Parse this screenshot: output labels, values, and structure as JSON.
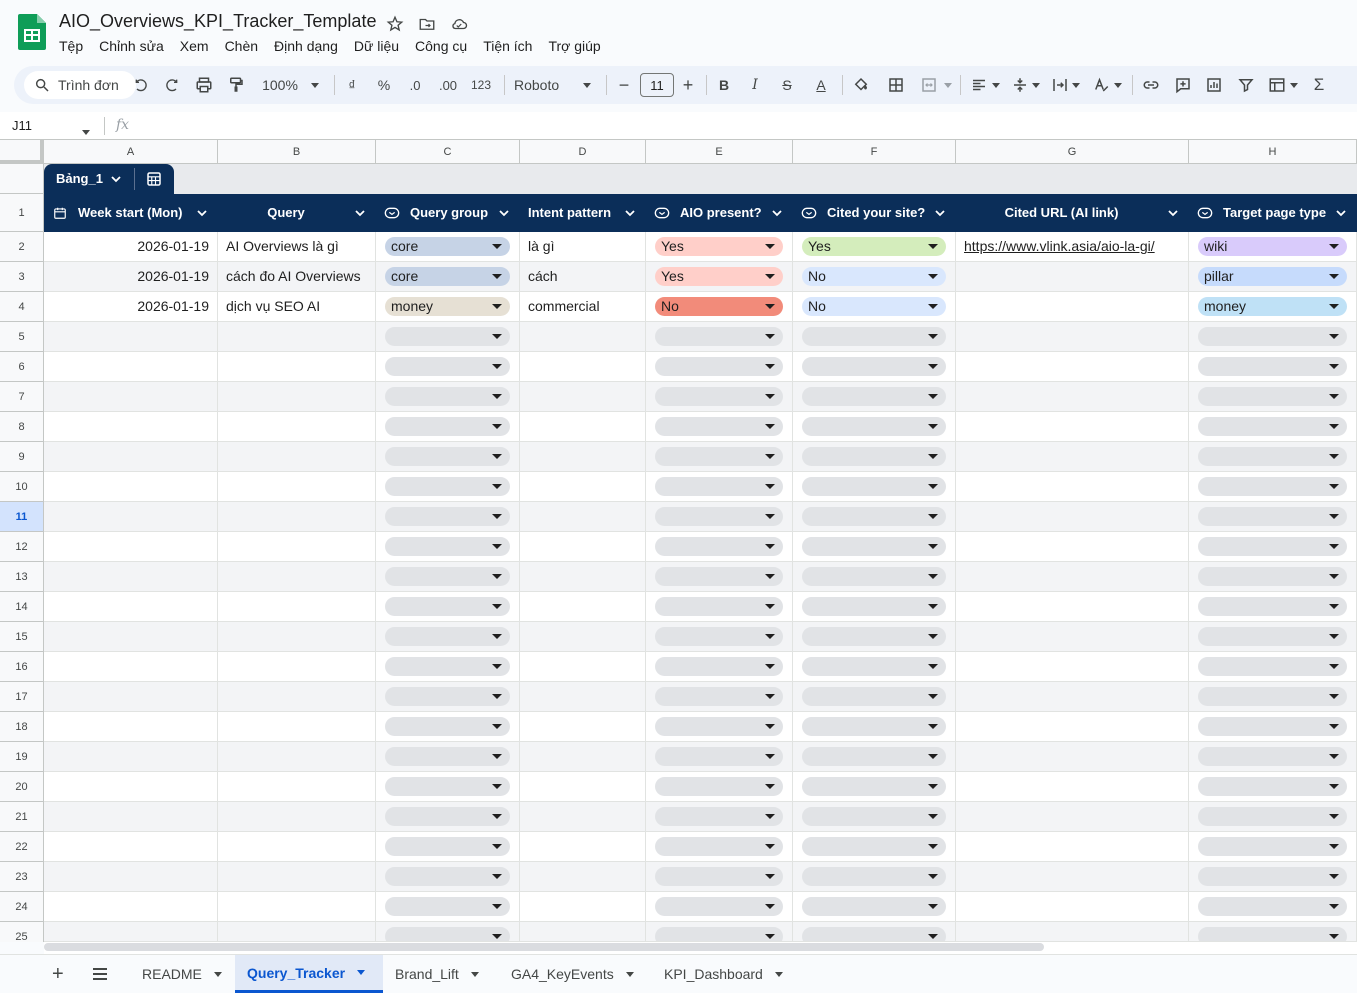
{
  "document": {
    "title": "AIO_Overviews_KPI_Tracker_Template"
  },
  "menu": [
    "Tệp",
    "Chỉnh sửa",
    "Xem",
    "Chèn",
    "Định dạng",
    "Dữ liệu",
    "Công cụ",
    "Tiện ích",
    "Trợ giúp"
  ],
  "toolbar": {
    "search_label": "Trình đơn",
    "zoom": "100%",
    "currency": "₫",
    "percent": "%",
    "decrease_decimal": ".0",
    "increase_decimal": ".00",
    "number_format": "123",
    "font": "Roboto",
    "font_size": "11",
    "minus": "−",
    "plus": "+",
    "bold": "B",
    "italic": "I",
    "strike": "S",
    "text_color": "A",
    "sum": "Σ"
  },
  "formula_bar": {
    "name_box": "J11",
    "fx": "fx"
  },
  "columns": [
    "A",
    "B",
    "C",
    "D",
    "E",
    "F",
    "G",
    "H"
  ],
  "table": {
    "name": "Bảng_1",
    "headers": [
      "Week start (Mon)",
      "Query",
      "Query group",
      "Intent pattern",
      "AIO present?",
      "Cited your site?",
      "Cited URL (AI link)",
      "Target page type"
    ],
    "rows": [
      {
        "week": "2026-01-19",
        "query": "AI Overviews là gì",
        "group": "core",
        "intent": "là gì",
        "aio": "Yes",
        "cited": "Yes",
        "url": "https://www.vlink.asia/aio-la-gi/",
        "target": "wiki"
      },
      {
        "week": "2026-01-19",
        "query": "cách đo AI Overviews",
        "group": "core",
        "intent": "cách",
        "aio": "Yes",
        "cited": "No",
        "url": "",
        "target": "pillar"
      },
      {
        "week": "2026-01-19",
        "query": "dịch vụ SEO AI",
        "group": "money",
        "intent": "commercial",
        "aio": "No",
        "cited": "No",
        "url": "",
        "target": "money"
      }
    ]
  },
  "row_numbers": [
    "1",
    "2",
    "3",
    "4",
    "5",
    "6",
    "7",
    "8",
    "9",
    "10",
    "11",
    "12",
    "13",
    "14",
    "15",
    "16",
    "17",
    "18",
    "19",
    "20",
    "21",
    "22",
    "23",
    "24",
    "25"
  ],
  "selected_row": "11",
  "chip_colors": {
    "core": "#c6d3e6",
    "money_group": "#e6e0d4",
    "aio_yes": "#ffcfc9",
    "aio_no": "#f28b7a",
    "cited_yes": "#d4edbc",
    "cited_no": "#d9e7fd",
    "wiki": "#d9cbfb",
    "pillar": "#c6dbfc",
    "money_target": "#bfe1f6",
    "empty": "#e1e3e6",
    "header": "#0b2e59"
  },
  "sheets": [
    {
      "name": "README",
      "active": false
    },
    {
      "name": "Query_Tracker",
      "active": true
    },
    {
      "name": "Brand_Lift",
      "active": false
    },
    {
      "name": "GA4_KeyEvents",
      "active": false
    },
    {
      "name": "KPI_Dashboard",
      "active": false
    }
  ]
}
